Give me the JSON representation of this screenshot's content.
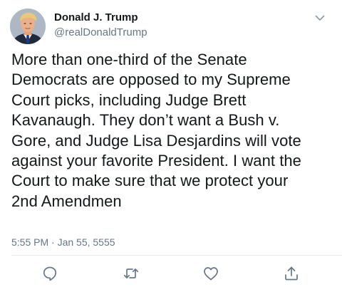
{
  "author": {
    "display_name": "Donald J. Trump",
    "handle": "@realDonaldTrump"
  },
  "tweet": {
    "lines": [
      "More than one-third of the Senate",
      "Democrats are opposed to my Supreme",
      "Court picks, including Judge Brett",
      "Kavanaugh. They don’t want a Bush v.",
      "Gore, and Judge Lisa Desjardins will vote",
      "against your favorite President. I want the",
      "Court to make sure that we protect your",
      "2nd Amendmen"
    ],
    "timestamp": "5:55 PM · Jan 55, 5555"
  },
  "icons": {
    "chevron": "chevron-down-icon",
    "reply": "reply-icon",
    "retweet": "retweet-icon",
    "like": "heart-icon",
    "share": "share-icon"
  },
  "colors": {
    "text": "#14171a",
    "secondary": "#657786",
    "icon": "#657786",
    "divider": "#e6ecf0"
  }
}
